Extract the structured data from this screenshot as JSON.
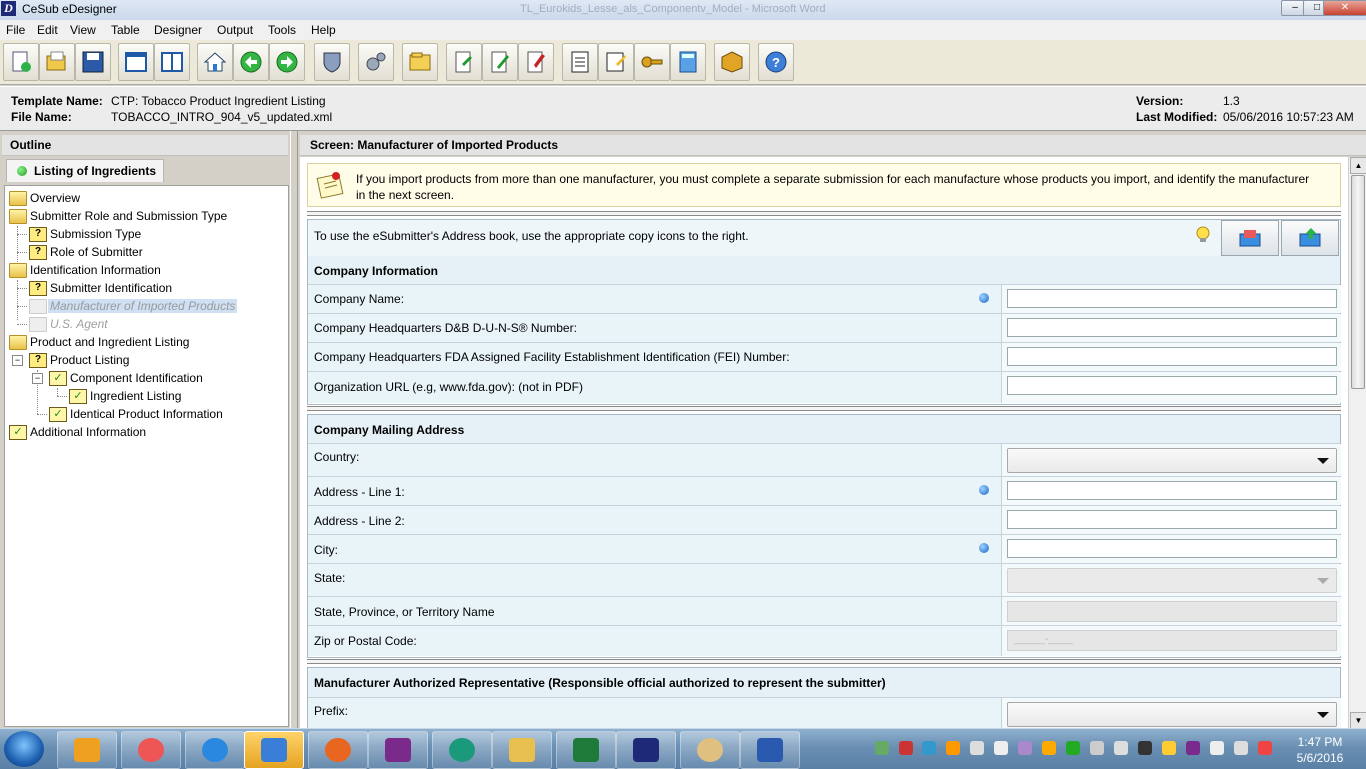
{
  "window": {
    "title": "CeSub eDesigner",
    "app_icon_letter": "D",
    "background_title": "TL_Eurokids_Lesse_als_Componentv_Model - Microsoft Word"
  },
  "menu": [
    "File",
    "Edit",
    "View",
    "Table",
    "Designer",
    "Output",
    "Tools",
    "Help"
  ],
  "toolbar_icons": [
    "new-document-icon",
    "open-folder-icon",
    "save-icon",
    "window-icon",
    "panel-icon",
    "home-icon",
    "back-icon",
    "forward-icon",
    "shield-icon",
    "settings-gears-icon",
    "folder-icon",
    "export-icon",
    "edit-icon",
    "validate-icon",
    "report-icon",
    "print-preview-icon",
    "key-icon",
    "calculator-icon",
    "package-icon",
    "help-icon"
  ],
  "info": {
    "template_label": "Template Name:",
    "template_value": "CTP: Tobacco Product Ingredient Listing",
    "file_label": "File Name:",
    "file_value": "TOBACCO_INTRO_904_v5_updated.xml",
    "version_label": "Version:",
    "version_value": "1.3",
    "modified_label": "Last Modified:",
    "modified_value": "05/06/2016 10:57:23 AM"
  },
  "outline": {
    "title": "Outline",
    "tab": "Listing of Ingredients",
    "items": [
      "Overview",
      "Submitter Role and Submission Type",
      "Submission Type",
      "Role of Submitter",
      "Identification Information",
      "Submitter Identification",
      "Manufacturer of Imported Products",
      "U.S. Agent",
      "Product and Ingredient Listing",
      "Product Listing",
      "Component Identification",
      "Ingredient Listing",
      "Identical Product Information",
      "Additional Information"
    ]
  },
  "screen": {
    "title": "Screen: Manufacturer of Imported Products",
    "note": "If you import products from more than one manufacturer, you must complete a separate submission for each manufacture whose products you import, and identify the manufacturer in the next screen.",
    "address_book_hint": "To use the eSubmitter's Address book, use the appropriate copy icons to the right.",
    "company_info": {
      "header": "Company Information",
      "fields": [
        "Company Name:",
        "Company Headquarters D&B D-U-N-S® Number:",
        "Company Headquarters FDA Assigned Facility Establishment Identification (FEI) Number:",
        "Organization URL (e.g, www.fda.gov): (not in PDF)"
      ]
    },
    "mailing": {
      "header": "Company Mailing Address",
      "fields": [
        "Country:",
        "Address - Line 1:",
        "Address - Line 2:",
        "City:",
        "State:",
        "State, Province, or Territory Name",
        "Zip or Postal Code:"
      ],
      "zip_mask": "_____-____"
    },
    "representative": {
      "header": "Manufacturer Authorized Representative (Responsible official authorized to represent the submitter)",
      "fields": [
        "Prefix:"
      ]
    }
  },
  "taskbar": {
    "apps": [
      "outlook",
      "snipping-tool",
      "internet-explorer",
      "remote-desktop",
      "firefox",
      "onenote",
      "chrome-like",
      "file-explorer",
      "excel",
      "edesigner",
      "paint",
      "word"
    ],
    "time": "1:47 PM",
    "date": "5/6/2016"
  }
}
